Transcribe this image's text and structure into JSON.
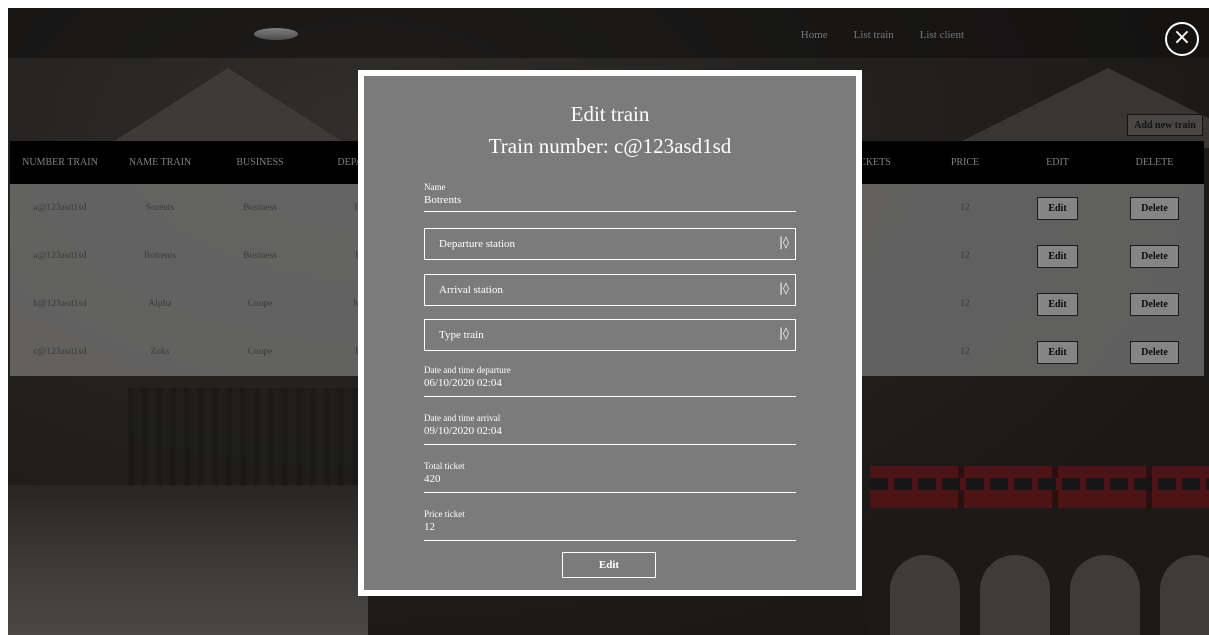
{
  "nav": {
    "links": [
      "Home",
      "List train",
      "List client"
    ]
  },
  "add_new_label": "Add new train",
  "table": {
    "headers": [
      "NUMBER TRAIN",
      "NAME TRAIN",
      "BUSINESS",
      "DEPA STA",
      "CKETS",
      "PRICE",
      "EDIT",
      "DELETE"
    ],
    "rows": [
      {
        "number": "a@123asd1sd",
        "name": "Sorents",
        "business": "Business",
        "dep": "Bo",
        "price": "12"
      },
      {
        "number": "a@123asd1sd",
        "name": "Botrents",
        "business": "Business",
        "dep": "Br",
        "price": "12"
      },
      {
        "number": "b@123asd1sd",
        "name": "Alpha",
        "business": "Coupe",
        "dep": "Mo",
        "price": "12"
      },
      {
        "number": "c@123asd1sd",
        "name": "Zoks",
        "business": "Coupe",
        "dep": "Br",
        "price": "12"
      }
    ],
    "edit_label": "Edit",
    "delete_label": "Delete"
  },
  "modal": {
    "title": "Edit train",
    "subtitle": "Train number: c@123asd1sd",
    "name_label": "Name",
    "name_value": "Botrents",
    "departure_select": "Departure station",
    "arrival_select": "Arrival station",
    "type_select": "Type train",
    "dt_departure_label": "Date and time departure",
    "dt_departure_value": "06/10/2020 02:04",
    "dt_arrival_label": "Date and time arrival",
    "dt_arrival_value": "09/10/2020 02:04",
    "total_label": "Total ticket",
    "total_value": "420",
    "price_label": "Price ticket",
    "price_value": "12",
    "submit_label": "Edit",
    "select_arrow": "|◊"
  }
}
